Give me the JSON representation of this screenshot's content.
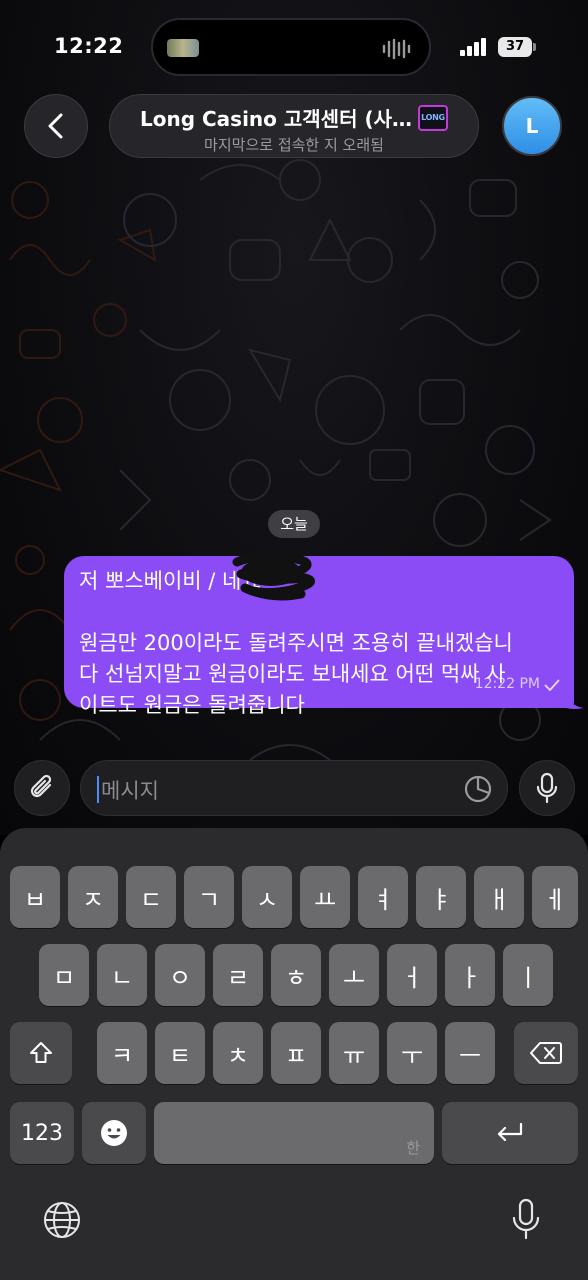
{
  "status_bar": {
    "time": "12:22",
    "battery": "37"
  },
  "header": {
    "title": "Long Casino 고객센터 (사…",
    "logo_text": "LONG",
    "subtitle": "마지막으로 접속한 지 오래됨",
    "avatar_letter": "L"
  },
  "chat": {
    "date_label": "오늘",
    "message": {
      "lines": [
        "저 뽀스베이비 /          네요",
        "원금만 200이라도 돌려주시면 조용히 끝내겠습니",
        "다 선넘지말고 원금이라도 보내세요 어떤 먹싸 사",
        "이트도 원금은 돌려줍니다"
      ],
      "time": "12:22 PM",
      "bubble_color": "#8b4cf6"
    }
  },
  "input": {
    "placeholder": "메시지"
  },
  "keyboard": {
    "row1": [
      "ㅂ",
      "ㅈ",
      "ㄷ",
      "ㄱ",
      "ㅅ",
      "ㅛ",
      "ㅕ",
      "ㅑ",
      "ㅐ",
      "ㅔ"
    ],
    "row2": [
      "ㅁ",
      "ㄴ",
      "ㅇ",
      "ㄹ",
      "ㅎ",
      "ㅗ",
      "ㅓ",
      "ㅏ",
      "ㅣ"
    ],
    "row3": [
      "ㅋ",
      "ㅌ",
      "ㅊ",
      "ㅍ",
      "ㅠ",
      "ㅜ",
      "ㅡ"
    ],
    "numbers_label": "123",
    "space_language": "한"
  },
  "icons": {
    "back": "chevron-left-icon",
    "attach": "paperclip-icon",
    "sticker": "sticker-icon",
    "mic": "microphone-icon",
    "emoji": "emoji-icon",
    "globe": "globe-icon",
    "dictation": "microphone-icon",
    "shift": "shift-icon",
    "delete": "delete-icon",
    "return": "return-icon"
  }
}
